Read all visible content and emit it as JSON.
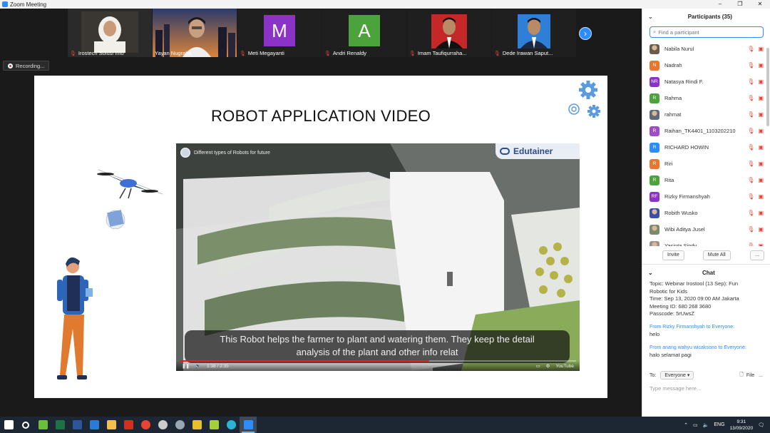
{
  "window": {
    "title": "Zoom Meeting",
    "controls": [
      "–",
      "❐",
      "✕"
    ]
  },
  "gallery": {
    "tiles": [
      {
        "name": "Irostech Solusi Info",
        "kind": "photo",
        "muted": true
      },
      {
        "name": "Yayan Nugraha",
        "kind": "photo",
        "muted": false,
        "selected": true
      },
      {
        "name": "Meti Megayanti",
        "kind": "letter",
        "letter": "M",
        "color": "#8a33c6",
        "muted": true
      },
      {
        "name": "Andri Renaldy",
        "kind": "letter",
        "letter": "A",
        "color": "#4ca33b",
        "muted": true
      },
      {
        "name": "Imam Taufiqurraha...",
        "kind": "photo",
        "muted": true
      },
      {
        "name": "Dede Irawan Saput...",
        "kind": "photo",
        "muted": true
      }
    ],
    "next_icon": "›"
  },
  "recording": {
    "label": "Recording..."
  },
  "slide": {
    "title": "ROBOT APPLICATION VIDEO",
    "video": {
      "title": "Different types of Robots for future",
      "brand": "Edutainer",
      "caption_line1": "This Robot helps the farmer to plant and watering them. They keep the detail",
      "caption_line2": "analysis  of the plant and other info relat",
      "time": "1:38 / 2:35",
      "progress": 0.63,
      "youtube_label": "YouTube"
    }
  },
  "participants": {
    "title": "Participants (35)",
    "search_placeholder": "Find a participant",
    "list": [
      {
        "name": "Nabila Nurul",
        "initials": "",
        "color": "#6b5b4b"
      },
      {
        "name": "Nadrah",
        "initials": "N",
        "color": "#e8772e"
      },
      {
        "name": "Natasya Rindi F.",
        "initials": "NR",
        "color": "#8a33c6"
      },
      {
        "name": "Rahma",
        "initials": "R",
        "color": "#4ca33b"
      },
      {
        "name": "rahmat",
        "initials": "",
        "color": "#5d6b7a"
      },
      {
        "name": "Raihan_TK4401_1103202210",
        "initials": "R",
        "color": "#a04cc6"
      },
      {
        "name": "RICHARD HOWIN",
        "initials": "R",
        "color": "#2d8cff"
      },
      {
        "name": "Riri",
        "initials": "R",
        "color": "#e8772e"
      },
      {
        "name": "Rita",
        "initials": "R",
        "color": "#4ca33b"
      },
      {
        "name": "Rizky Firmanshyah",
        "initials": "RF",
        "color": "#8a33c6"
      },
      {
        "name": "Robith Wusko",
        "initials": "",
        "color": "#3a4fa8"
      },
      {
        "name": "Wibi Aditya Jusel",
        "initials": "",
        "color": "#7a8a6a"
      },
      {
        "name": "Yasinta Sindy",
        "initials": "",
        "color": "#9a8e8a"
      }
    ],
    "invite_label": "Invite",
    "mute_all_label": "Mute All",
    "more_label": "..."
  },
  "chat": {
    "title": "Chat",
    "topic_lines": [
      "Topic: Webinar Irostool (13 Sep): Fun",
      "Robotic for Kids",
      "Time: Sep 13, 2020 09:00 AM Jakarta",
      "Meeting ID: 680 268 3680",
      "Passcode: 5rUwsZ"
    ],
    "messages": [
      {
        "from": "From Rizky Firmanshyah to Everyone:",
        "text": "helo"
      },
      {
        "from": "From anang wahyu wicaksono to Everyone:",
        "text": "halo selamat pagi"
      }
    ],
    "to_label": "To:",
    "to_value": "Everyone",
    "file_label": "File",
    "more_label": "...",
    "input_placeholder": "Type message here..."
  },
  "taskbar": {
    "time": "9:31",
    "date": "13/09/2020",
    "icons": [
      {
        "name": "start-icon",
        "color": "#ffffff"
      },
      {
        "name": "search-icon",
        "color": "#ffffff"
      },
      {
        "name": "frog-app-icon",
        "color": "#6bbf3a"
      },
      {
        "name": "excel-icon",
        "color": "#1e7145"
      },
      {
        "name": "word-icon",
        "color": "#2b579a"
      },
      {
        "name": "vector-app-icon",
        "color": "#2a7ad6"
      },
      {
        "name": "folder-icon",
        "color": "#f2c14e"
      },
      {
        "name": "acrobat-icon",
        "color": "#d62d20"
      },
      {
        "name": "chrome-icon",
        "color": "#e94335"
      },
      {
        "name": "speedometer-icon",
        "color": "#cccccc"
      },
      {
        "name": "globe-app-icon",
        "color": "#9aa6b3"
      },
      {
        "name": "sync-app-icon",
        "color": "#e6c229"
      },
      {
        "name": "notes-app-icon",
        "color": "#a6cf3a"
      },
      {
        "name": "edge-icon",
        "color": "#2bb3d6"
      },
      {
        "name": "zoom-icon",
        "color": "#2d8cff"
      }
    ]
  }
}
